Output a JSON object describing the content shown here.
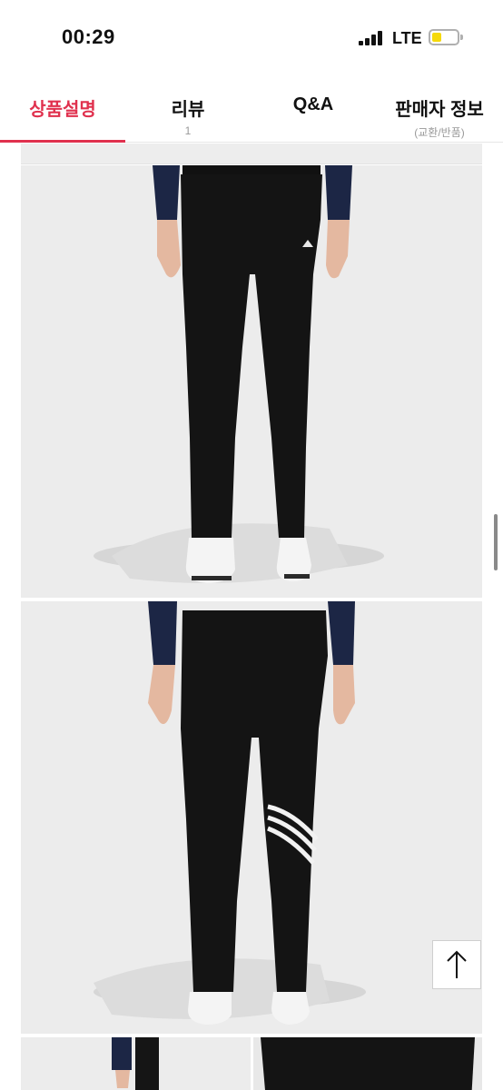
{
  "status_bar": {
    "time": "00:29",
    "network": "LTE",
    "battery_level": 0.4,
    "battery_color": "#f5d90a"
  },
  "tabs": [
    {
      "label": "상품설명",
      "sub": "",
      "active": true
    },
    {
      "label": "리뷰",
      "sub": "1",
      "active": false
    },
    {
      "label": "Q&A",
      "sub": "",
      "active": false
    },
    {
      "label": "판매자 정보",
      "sub": "(교환/반품)",
      "active": false
    }
  ],
  "colors": {
    "accent": "#e0314e",
    "photo_background": "#ececec"
  },
  "icons": {
    "scroll_top": "arrow-up-icon"
  }
}
